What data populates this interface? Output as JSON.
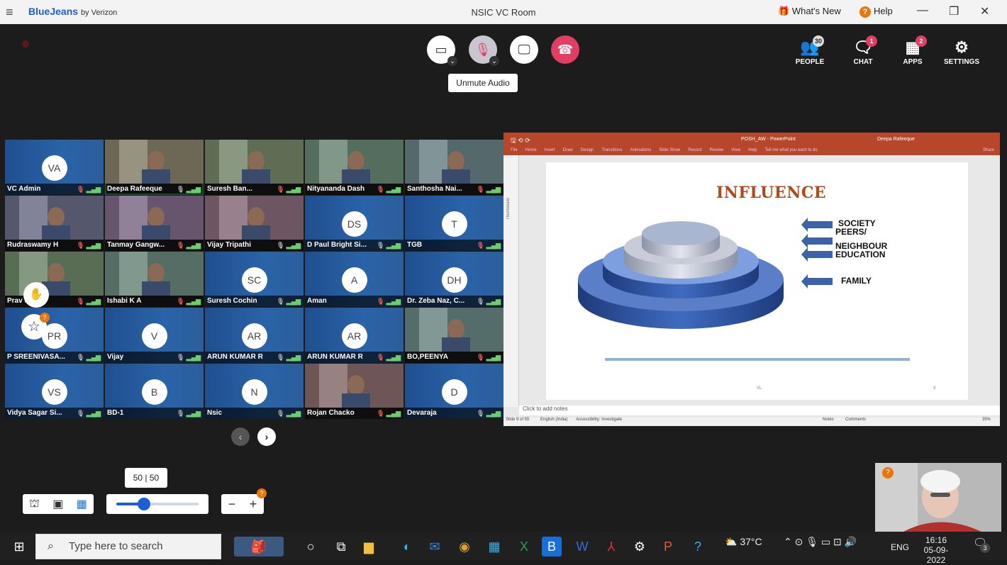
{
  "titlebar": {
    "brand": "BlueJeans",
    "brand_suffix": "by Verizon",
    "window_title": "NSIC VC Room",
    "whats_new": "What's New",
    "help": "Help"
  },
  "controls": {
    "tooltip": "Unmute Audio",
    "people": {
      "label": "PEOPLE",
      "count": "30"
    },
    "chat": {
      "label": "CHAT",
      "count": "1"
    },
    "apps": {
      "label": "APPS",
      "count": "2"
    },
    "settings": {
      "label": "SETTINGS"
    }
  },
  "tiles": [
    {
      "name": "VC  Admin",
      "initials": "VA",
      "video": false,
      "muted": true
    },
    {
      "name": "Deepa Rafeeque",
      "initials": "",
      "video": true,
      "muted": false,
      "active": true
    },
    {
      "name": "Suresh Ban...",
      "initials": "",
      "video": true,
      "muted": true
    },
    {
      "name": "Nityananda Dash",
      "initials": "",
      "video": true,
      "muted": true
    },
    {
      "name": "Santhosha Nai...",
      "initials": "",
      "video": true,
      "muted": true
    },
    {
      "name": "Rudraswamy H",
      "initials": "",
      "video": true,
      "muted": true
    },
    {
      "name": "Tanmay Gangw...",
      "initials": "",
      "video": true,
      "muted": true
    },
    {
      "name": "Vijay Tripathi",
      "initials": "",
      "video": true,
      "muted": false
    },
    {
      "name": "D Paul Bright Si...",
      "initials": "DS",
      "video": false,
      "muted": false
    },
    {
      "name": "TGB",
      "initials": "T",
      "video": false,
      "muted": true
    },
    {
      "name": "Prav    dhol",
      "initials": "",
      "video": true,
      "muted": true
    },
    {
      "name": "Ishabi K A",
      "initials": "",
      "video": true,
      "muted": true
    },
    {
      "name": "Suresh Cochin",
      "initials": "SC",
      "video": false,
      "muted": false
    },
    {
      "name": "Aman",
      "initials": "A",
      "video": false,
      "muted": true
    },
    {
      "name": "Dr. Zeba Naz, C...",
      "initials": "DH",
      "video": false,
      "muted": false
    },
    {
      "name": "P SREENIVASA...",
      "initials": "PR",
      "video": false,
      "muted": false
    },
    {
      "name": "Vijay",
      "initials": "V",
      "video": false,
      "muted": false
    },
    {
      "name": "ARUN KUMAR  R",
      "initials": "AR",
      "video": false,
      "muted": false
    },
    {
      "name": "ARUN KUMAR R",
      "initials": "AR",
      "video": false,
      "muted": true
    },
    {
      "name": "BO,PEENYA",
      "initials": "",
      "video": true,
      "muted": true
    },
    {
      "name": "Vidya Sagar Si...",
      "initials": "VS",
      "video": false,
      "muted": false
    },
    {
      "name": "BD-1",
      "initials": "B",
      "video": false,
      "muted": false
    },
    {
      "name": "Nsic",
      "initials": "N",
      "video": false,
      "muted": false
    },
    {
      "name": "Rojan Chacko",
      "initials": "",
      "video": true,
      "muted": true
    },
    {
      "name": "Devaraja",
      "initials": "D",
      "video": false,
      "muted": false
    }
  ],
  "ppt": {
    "title": "POSH_AW  -  PowerPoint",
    "user": "Deepa Rafeeque",
    "menu": [
      "File",
      "Home",
      "Insert",
      "Draw",
      "Design",
      "Transitions",
      "Animations",
      "Slide Show",
      "Record",
      "Review",
      "View",
      "Help",
      "Tell me what you want to do"
    ],
    "share": "Share",
    "thumbnails": "Thumbnails",
    "slide_title": "INFLUENCE",
    "labels": [
      "SOCIETY",
      "PEERS/",
      "NEIGHBOUR",
      "EDUCATION",
      "FAMILY"
    ],
    "footer_left": "VL",
    "footer_right": "9",
    "notes": "Click to add notes",
    "status_left": "Slide 9 of 55",
    "status_lang": "English (India)",
    "status_access": "Accessibility: Investigate",
    "status_notes": "Notes",
    "status_comments": "Comments",
    "status_zoom": "35%"
  },
  "bottom": {
    "zoom_tip": "50 | 50",
    "badge": "?"
  },
  "taskbar": {
    "search": "Type here to search",
    "temp": "37°C",
    "lang": "ENG",
    "time": "16:16",
    "date": "05-09-2022",
    "notif": "3"
  }
}
